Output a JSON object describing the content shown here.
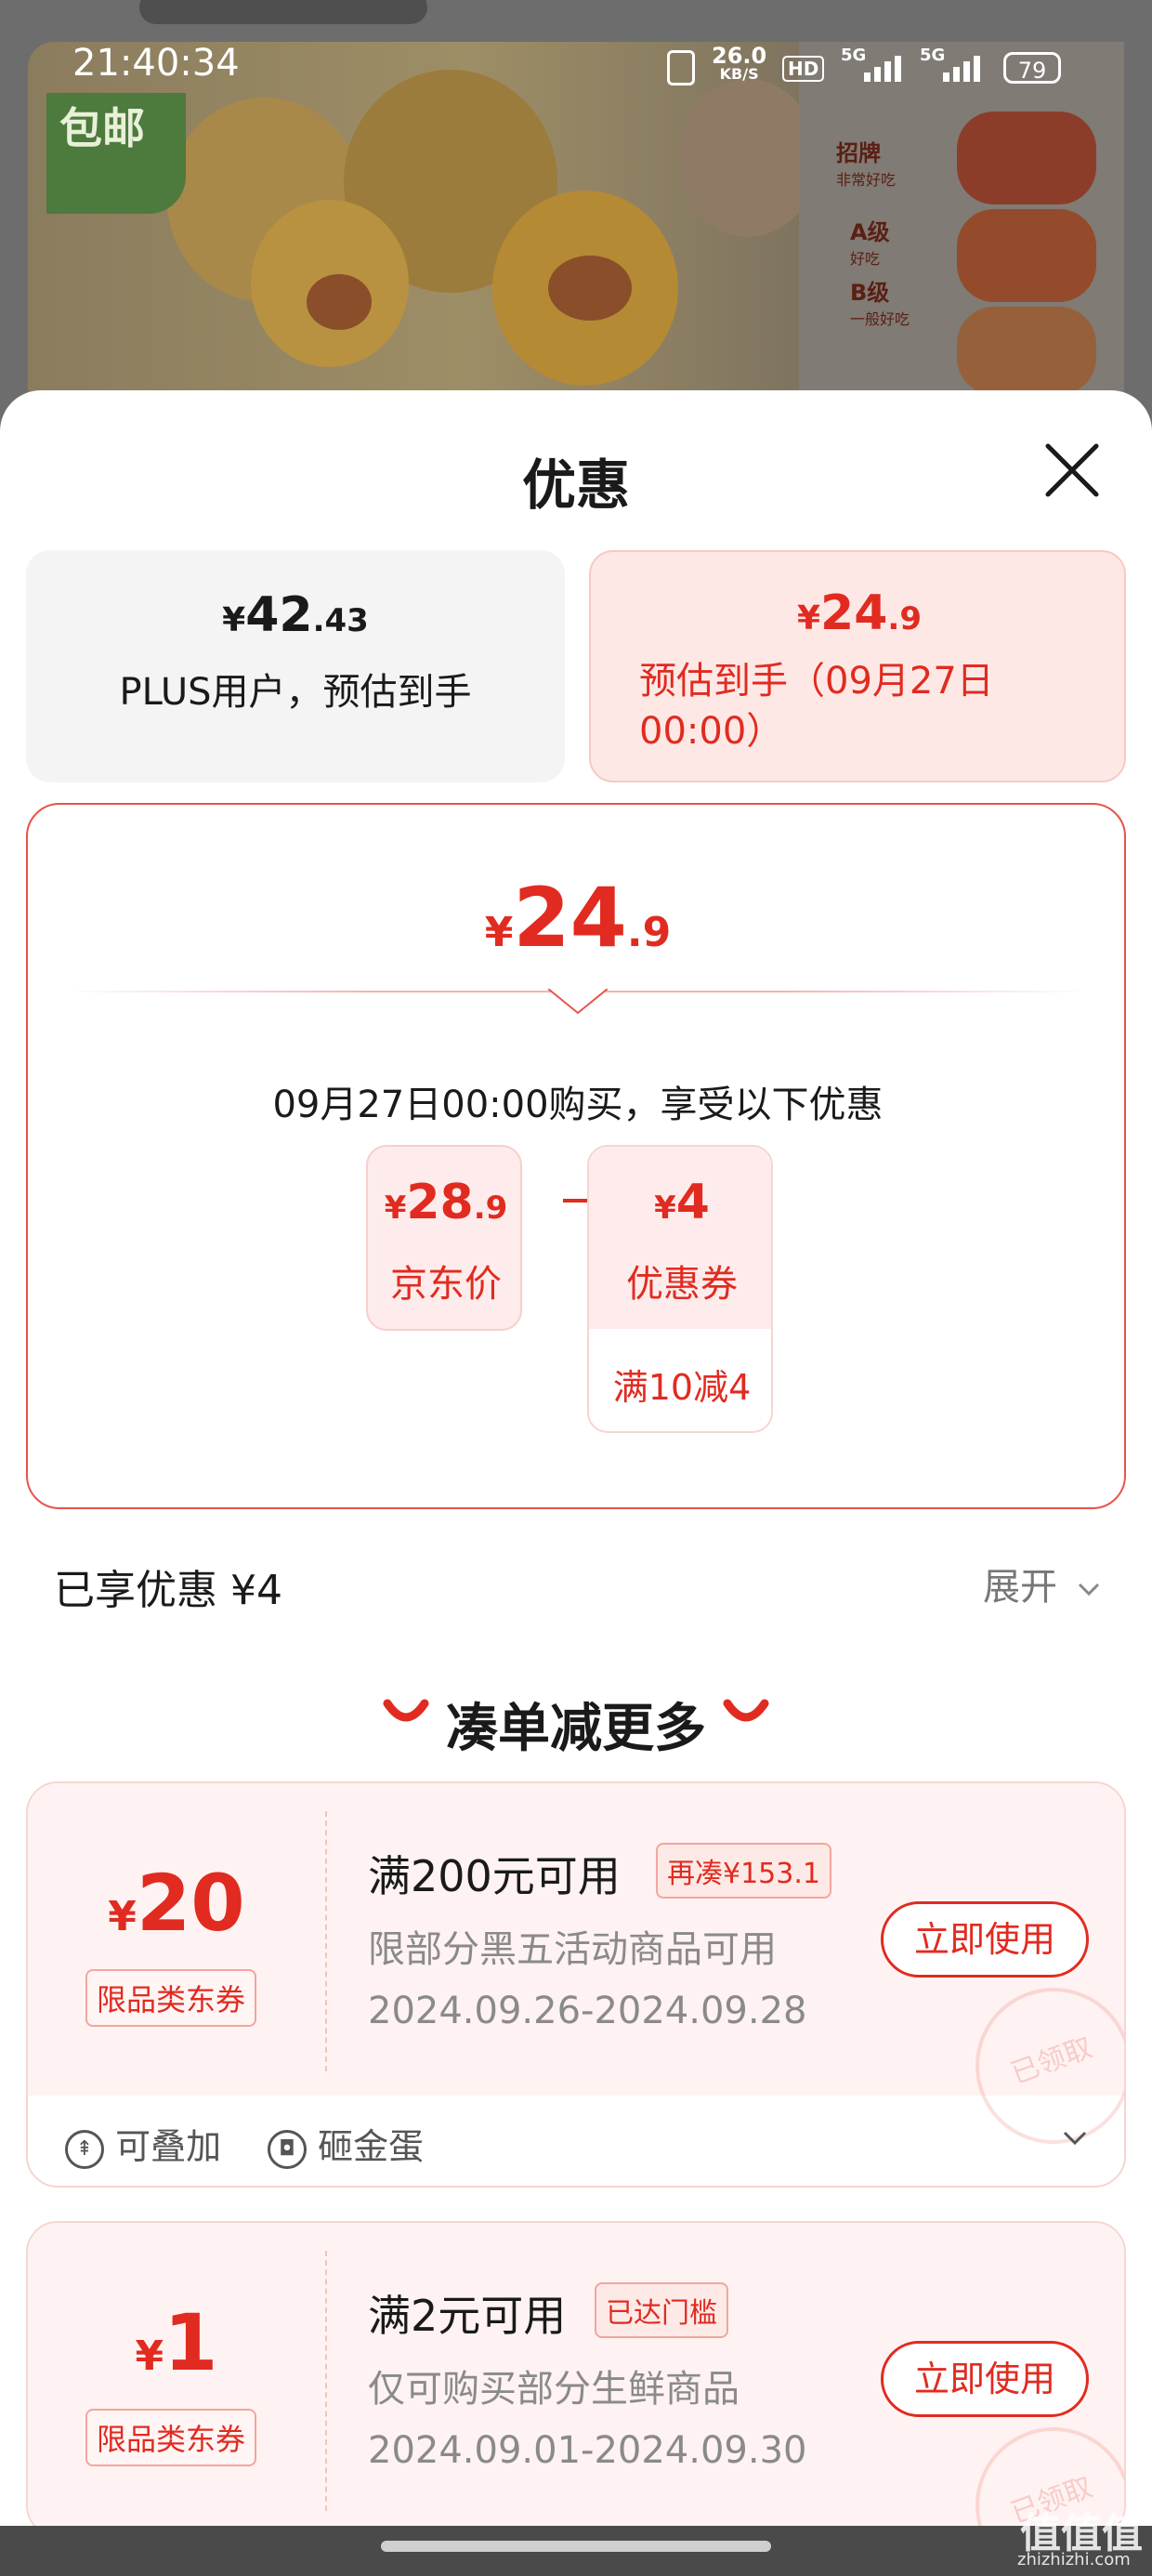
{
  "status_bar": {
    "time": "21:40:34",
    "net_speed": "26.0",
    "net_unit": "KB/S",
    "hd": "HD",
    "net1": "5G",
    "net2": "5G",
    "battery": "79"
  },
  "background": {
    "free_shipping": "包邮",
    "grades": [
      {
        "label": "招牌",
        "sub": "非常好吃"
      },
      {
        "label": "A级",
        "sub": "好吃"
      },
      {
        "label": "B级",
        "sub": "一般好吃"
      }
    ]
  },
  "sheet": {
    "title": "优惠",
    "plus_card": {
      "yen": "¥",
      "price_int": "42",
      "price_dec": ".43",
      "label": "PLUS用户，预估到手"
    },
    "est_card": {
      "yen": "¥",
      "price_int": "24",
      "price_dec": ".9",
      "label_line1": "预估到手（09月27日",
      "label_line2": "00:00）"
    },
    "main": {
      "yen": "¥",
      "price_int": "24",
      "price_dec": ".9",
      "desc": "09月27日00:00购买，享受以下优惠",
      "jd_price": {
        "yen": "¥",
        "int": "28",
        "dec": ".9",
        "label": "京东价"
      },
      "minus": "-",
      "coupon": {
        "yen": "¥",
        "amount": "4",
        "label": "优惠券",
        "rule": "满10减4"
      }
    },
    "enjoyed": "已享优惠 ¥4",
    "expand_label": "展开",
    "more_title": "凑单减更多",
    "coupons": [
      {
        "yen": "¥",
        "amount": "20",
        "type": "限品类东券",
        "title": "满200元可用",
        "badge": "再凑¥153.1",
        "desc": "限部分黑五活动商品可用",
        "period": "2024.09.26-2024.09.28",
        "button": "立即使用",
        "stamp": "已领取",
        "footer_a": "可叠加",
        "footer_b": "砸金蛋"
      },
      {
        "yen": "¥",
        "amount": "1",
        "type": "限品类东券",
        "title": "满2元可用",
        "badge": "已达门槛",
        "desc": "仅可购买部分生鲜商品",
        "period": "2024.09.01-2024.09.30",
        "button": "立即使用",
        "stamp": "已领取"
      }
    ]
  },
  "watermark": {
    "logo": "值值值",
    "site": "zhizhizhi.com"
  },
  "colors": {
    "accent": "#e12b20",
    "pink_bg": "#fdeceb",
    "border": "#e9534a"
  }
}
